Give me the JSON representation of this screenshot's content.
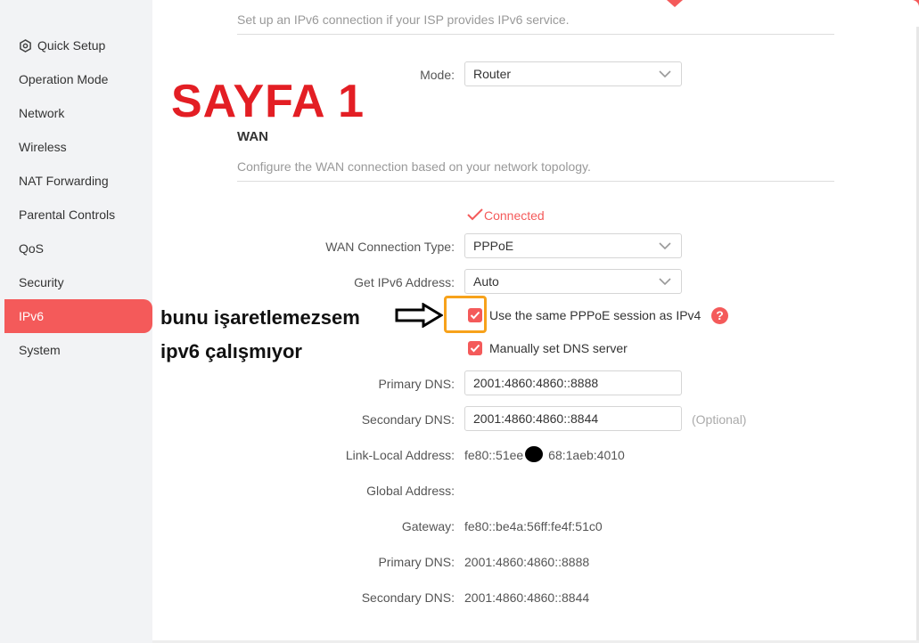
{
  "sidebar": {
    "items": [
      {
        "label": "Quick Setup",
        "icon": "gear-icon"
      },
      {
        "label": "Operation Mode"
      },
      {
        "label": "Network"
      },
      {
        "label": "Wireless"
      },
      {
        "label": "NAT Forwarding"
      },
      {
        "label": "Parental Controls"
      },
      {
        "label": "QoS"
      },
      {
        "label": "Security"
      },
      {
        "label": "IPv6",
        "active": true
      },
      {
        "label": "System"
      }
    ]
  },
  "ipv6_section": {
    "description": "Set up an IPv6 connection if your ISP provides IPv6 service.",
    "mode_label": "Mode:",
    "mode_value": "Router"
  },
  "wan": {
    "title": "WAN",
    "description": "Configure the WAN connection based on your network topology.",
    "status": "Connected",
    "connection_type_label": "WAN Connection Type:",
    "connection_type_value": "PPPoE",
    "get_ipv6_label": "Get IPv6 Address:",
    "get_ipv6_value": "Auto",
    "same_session_label": "Use the same PPPoE session as IPv4",
    "same_session_checked": true,
    "manual_dns_label": "Manually set DNS server",
    "manual_dns_checked": true,
    "primary_dns_label": "Primary DNS:",
    "primary_dns_value": "2001:4860:4860::8888",
    "secondary_dns_label": "Secondary DNS:",
    "secondary_dns_value": "2001:4860:4860::8844",
    "optional_hint": "(Optional)",
    "link_local_label": "Link-Local Address:",
    "link_local_value_a": "fe80::51ee",
    "link_local_value_b": "68:1aeb:4010",
    "global_address_label": "Global Address:",
    "global_address_value": "",
    "gateway_label": "Gateway:",
    "gateway_value": "fe80::be4a:56ff:fe4f:51c0",
    "status_primary_dns_label": "Primary DNS:",
    "status_primary_dns_value": "2001:4860:4860::8888",
    "status_secondary_dns_label": "Secondary DNS:",
    "status_secondary_dns_value": "2001:4860:4860::8844"
  },
  "annotation": {
    "title": "SAYFA 1",
    "note_line1": "bunu işaretlemezsem",
    "note_line2": "ipv6 çalışmıyor"
  },
  "colors": {
    "accent": "#f45a5a",
    "annotation_red": "#e31e24",
    "highlight_orange": "#f7a21b"
  }
}
